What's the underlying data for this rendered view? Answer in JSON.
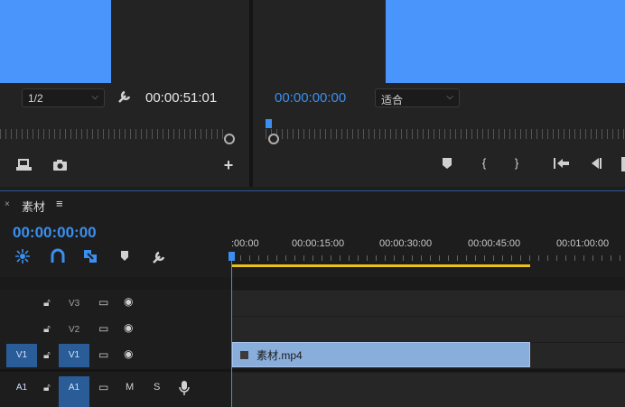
{
  "source_monitor": {
    "resolution": "1/2",
    "timecode": "00:00:51:01"
  },
  "program_monitor": {
    "timecode": "00:00:00:00",
    "fit": "适合"
  },
  "timeline": {
    "close": "×",
    "title": "素材",
    "menu": "≡",
    "timecode": "00:00:00:00",
    "ruler": [
      ":00:00",
      "00:00:15:00",
      "00:00:30:00",
      "00:00:45:00",
      "00:01:00:00"
    ],
    "tracks": [
      {
        "label": "V3",
        "target": "",
        "targeted": false
      },
      {
        "label": "V2",
        "target": "",
        "targeted": false
      },
      {
        "label": "V1",
        "target": "V1",
        "targeted": true
      },
      {
        "label": "A1",
        "target": "A1",
        "targeted": true
      }
    ],
    "audio_m": "M",
    "audio_s": "S",
    "clip": "素材.mp4"
  },
  "colors": {
    "accent": "#3a8ff0",
    "video": "#4a95fb",
    "clip": "#8aaedc",
    "workarea": "#e9c21a"
  }
}
